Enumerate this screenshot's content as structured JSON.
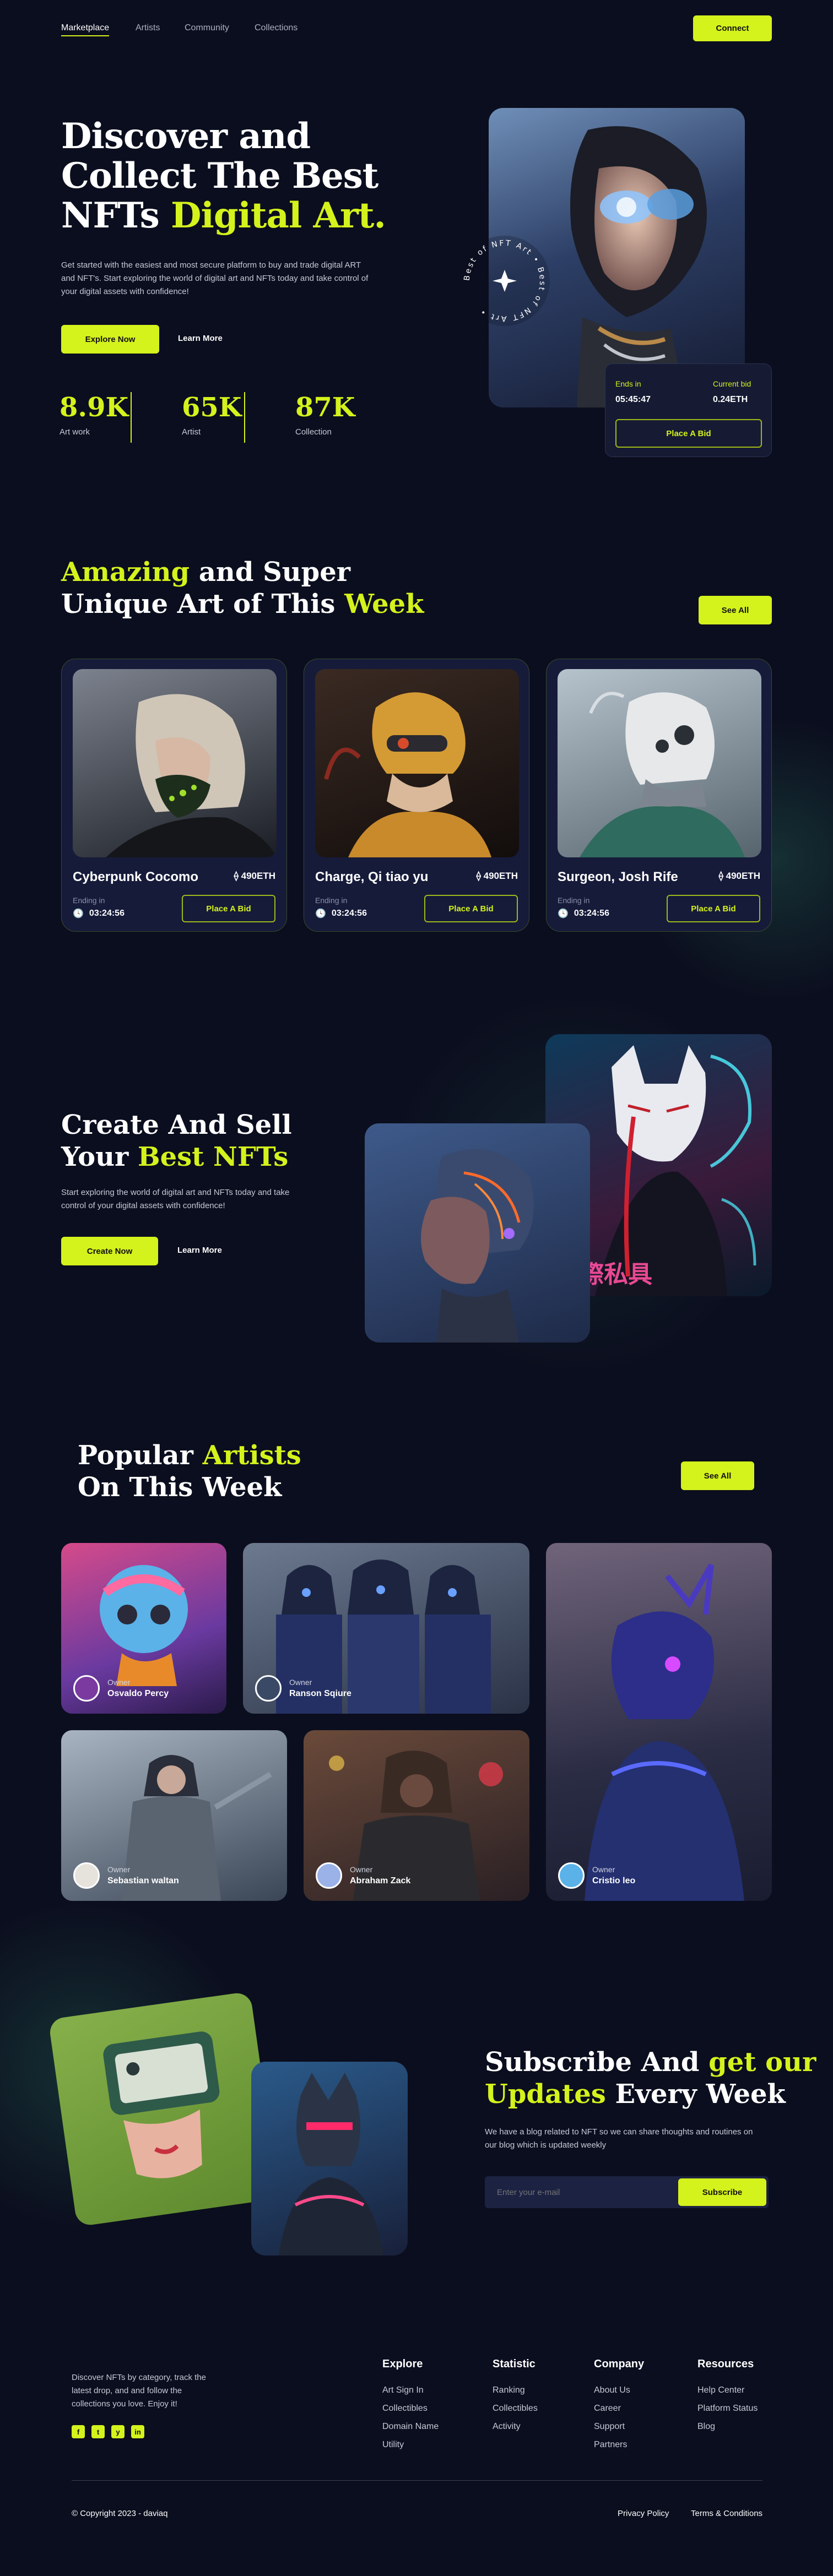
{
  "nav": {
    "links": [
      "Marketplace",
      "Artists",
      "Community",
      "Collections"
    ],
    "connect": "Connect"
  },
  "hero": {
    "title_l1": "Discover and",
    "title_l2": "Collect The Best",
    "title_l3a": "NFTs",
    "title_l3b": "Digital Art.",
    "description": "Get started with the easiest and most secure platform to buy and trade digital ART and NFT's. Start exploring the world of digital art and NFTs today and take control of your digital assets with confidence!",
    "explore": "Explore Now",
    "learn": "Learn More",
    "stats": [
      {
        "value": "8.9K",
        "label": "Art work"
      },
      {
        "value": "65K",
        "label": "Artist"
      },
      {
        "value": "87K",
        "label": "Collection"
      }
    ],
    "badge_text": "Best of NFT Art  •  Best of NFT Art  •",
    "ends_label": "Ends in",
    "ends_value": "05:45:47",
    "bid_label": "Current bid",
    "bid_value": "0.24ETH",
    "place_bid": "Place A Bid"
  },
  "amazing": {
    "t1a": "Amazing",
    "t1b": "and Super",
    "t2a": "Unique Art of This",
    "t2b": "Week",
    "see_all": "See All",
    "cards": [
      {
        "name": "Cyberpunk Cocomo",
        "price": "490ETH",
        "ending": "Ending in",
        "time": "03:24:56",
        "bid": "Place A Bid"
      },
      {
        "name": "Charge, Qi tiao yu",
        "price": "490ETH",
        "ending": "Ending in",
        "time": "03:24:56",
        "bid": "Place A Bid"
      },
      {
        "name": "Surgeon, Josh Rife",
        "price": "490ETH",
        "ending": "Ending in",
        "time": "03:24:56",
        "bid": "Place A Bid"
      }
    ]
  },
  "create": {
    "t1": "Create And Sell",
    "t2a": "Your",
    "t2b": "Best NFTs",
    "description": "Start exploring the world of digital art and NFTs today and take control of your digital assets with confidence!",
    "create_btn": "Create Now",
    "learn": "Learn More",
    "neon_sign": "国際私具"
  },
  "artists": {
    "t1a": "Popular",
    "t1b": "Artists",
    "t2": "On This Week",
    "see_all": "See All",
    "owner_label": "Owner",
    "names": [
      "Osvaldo Percy",
      "Ranson Sqiure",
      "Sebastian waltan",
      "Abraham Zack",
      "Cristio leo"
    ]
  },
  "subscribe": {
    "t1a": "Subscribe And",
    "t1b": "get our",
    "t2a": "Updates",
    "t2b": "Every Week",
    "description": "We have a blog related to NFT so we can share thoughts and routines on our blog which is updated weekly",
    "placeholder": "Enter your e-mail",
    "button": "Subscribe"
  },
  "footer": {
    "about": "Discover NFTs by category, track the latest drop, and and follow the collections you love. Enjoy it!",
    "socials": [
      "f",
      "t",
      "y",
      "in"
    ],
    "columns": [
      {
        "title": "Explore",
        "links": [
          "Art Sign In",
          "Collectibles",
          "Domain Name",
          "Utility"
        ]
      },
      {
        "title": "Statistic",
        "links": [
          "Ranking",
          "Collectibles",
          "Activity"
        ]
      },
      {
        "title": "Company",
        "links": [
          "About Us",
          "Career",
          "Support",
          "Partners"
        ]
      },
      {
        "title": "Resources",
        "links": [
          "Help Center",
          "Platform Status",
          "Blog"
        ]
      }
    ],
    "copyright": "© Copyright 2023 - daviaq",
    "privacy": "Privacy Policy",
    "terms": "Terms & Conditions"
  },
  "colors": {
    "bg": "#0b0e1e",
    "accent": "#d4f21c",
    "card": "#161b3a"
  }
}
